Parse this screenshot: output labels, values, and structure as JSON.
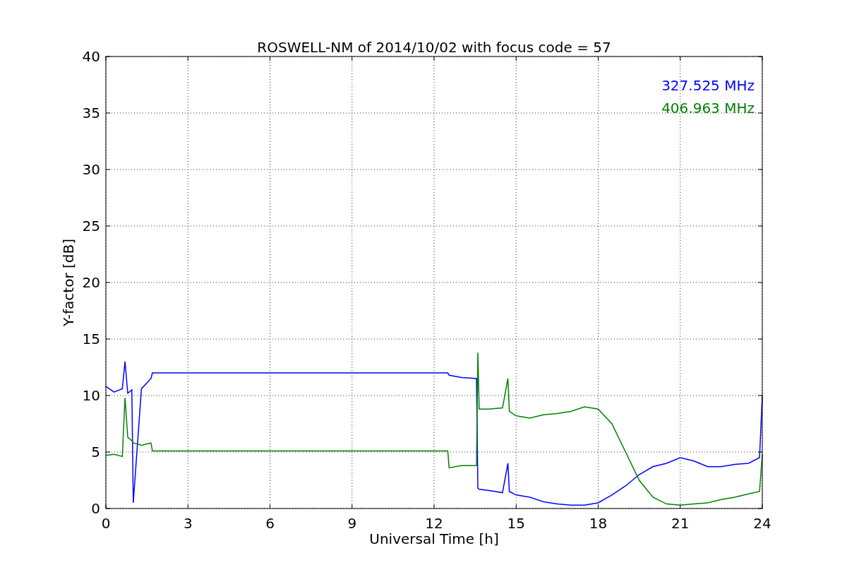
{
  "chart_data": {
    "type": "line",
    "title": "ROSWELL-NM of 2014/10/02 with focus code = 57",
    "xlabel": "Universal Time [h]",
    "ylabel": "Y-factor [dB]",
    "x": [
      0,
      0.3,
      0.6,
      0.7,
      0.8,
      0.95,
      1.0,
      1.3,
      1.65,
      1.7,
      3,
      6,
      9,
      12,
      12.5,
      12.55,
      13,
      13.55,
      13.6,
      13.65,
      14,
      14.5,
      14.7,
      14.75,
      15,
      15.5,
      16,
      16.5,
      17,
      17.5,
      18,
      18.5,
      19,
      19.5,
      20,
      20.5,
      21,
      21.5,
      22,
      22.5,
      23,
      23.5,
      23.9,
      24
    ],
    "series": [
      {
        "name": "327.525 MHz",
        "color": "#0000ff",
        "values": [
          10.8,
          10.3,
          10.6,
          13,
          10.2,
          10.5,
          0.5,
          10.6,
          11.5,
          12,
          12,
          12,
          12,
          12,
          12,
          11.8,
          11.6,
          11.5,
          1.8,
          1.7,
          1.6,
          1.4,
          4,
          1.5,
          1.2,
          1,
          0.6,
          0.4,
          0.3,
          0.3,
          0.5,
          1.2,
          2,
          3,
          3.7,
          4,
          4.5,
          4.2,
          3.7,
          3.7,
          3.9,
          4,
          4.5,
          10
        ]
      },
      {
        "name": "406.963 MHz",
        "color": "#008000",
        "values": [
          4.7,
          4.8,
          4.6,
          9.8,
          6.3,
          6,
          5.8,
          5.6,
          5.8,
          5.1,
          5.1,
          5.1,
          5.1,
          5.1,
          5.1,
          3.6,
          3.8,
          3.8,
          13.8,
          8.8,
          8.8,
          8.9,
          11.5,
          8.6,
          8.2,
          8,
          8.3,
          8.4,
          8.6,
          9,
          8.8,
          7.5,
          5,
          2.5,
          1,
          0.4,
          0.3,
          0.4,
          0.5,
          0.8,
          1,
          1.3,
          1.5,
          4.8
        ]
      }
    ],
    "xlim": [
      0,
      24
    ],
    "ylim": [
      0,
      40
    ],
    "xticks": [
      0,
      3,
      6,
      9,
      12,
      15,
      18,
      21,
      24
    ],
    "yticks": [
      0,
      5,
      10,
      15,
      20,
      25,
      30,
      35,
      40
    ],
    "grid": true
  }
}
